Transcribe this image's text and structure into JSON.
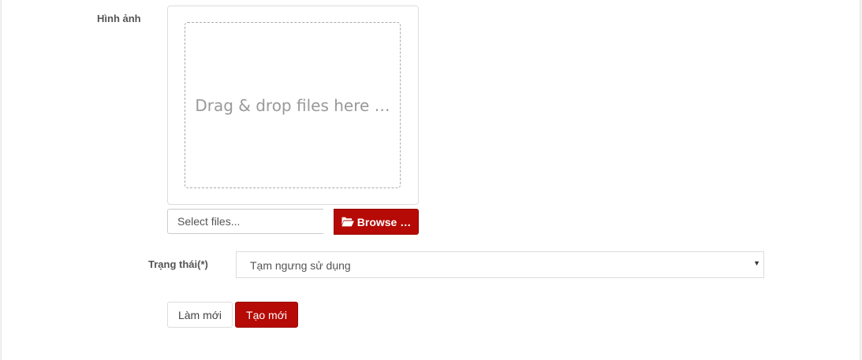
{
  "form": {
    "image_label": "Hình ảnh",
    "dropzone_text": "Drag & drop files here …",
    "file_input_placeholder": "Select files...",
    "browse_label": "Browse …",
    "status_label": "Trạng thái(*)",
    "status_value": "Tạm ngưng sử dụng",
    "reset_label": "Làm mới",
    "create_label": "Tạo mới"
  },
  "colors": {
    "accent": "#b50a05",
    "label": "#555555",
    "dropzone_text": "#999999"
  },
  "icons": {
    "browse": "folder-open-icon",
    "select_arrow": "caret-down-icon"
  }
}
